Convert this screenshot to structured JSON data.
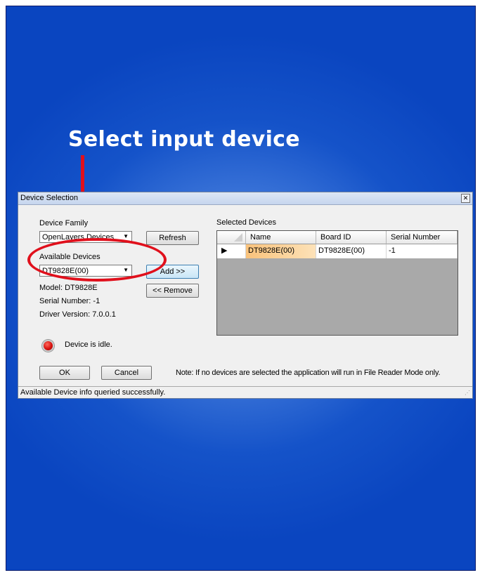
{
  "slide": {
    "title": "Select input device"
  },
  "dialog": {
    "title": "Device Selection",
    "close_glyph": "✕",
    "device_family": {
      "label": "Device Family",
      "value": "OpenLayers Devices"
    },
    "available_devices": {
      "label": "Available Devices",
      "value": "DT9828E(00)"
    },
    "info": {
      "model": "Model: DT9828E",
      "serial": "Serial Number: -1",
      "driver": "Driver Version: 7.0.0.1"
    },
    "buttons": {
      "refresh": "Refresh",
      "add": "Add >>",
      "remove": "<< Remove",
      "ok": "OK",
      "cancel": "Cancel"
    },
    "selected_devices": {
      "label": "Selected Devices",
      "columns": [
        "Name",
        "Board ID",
        "Serial Number"
      ],
      "rows": [
        {
          "name": "DT9828E(00)",
          "board_id": "DT9828E(00)",
          "serial": "-1"
        }
      ]
    },
    "status_text": "Device is idle.",
    "note": "Note: If no devices are selected the application will run in File Reader Mode only.",
    "statusbar": "Available Device info queried successfully."
  },
  "colors": {
    "background": "#1553c9",
    "callout": "#e0101c",
    "selected_row": "#f9c27b",
    "led": "#d8120f"
  }
}
